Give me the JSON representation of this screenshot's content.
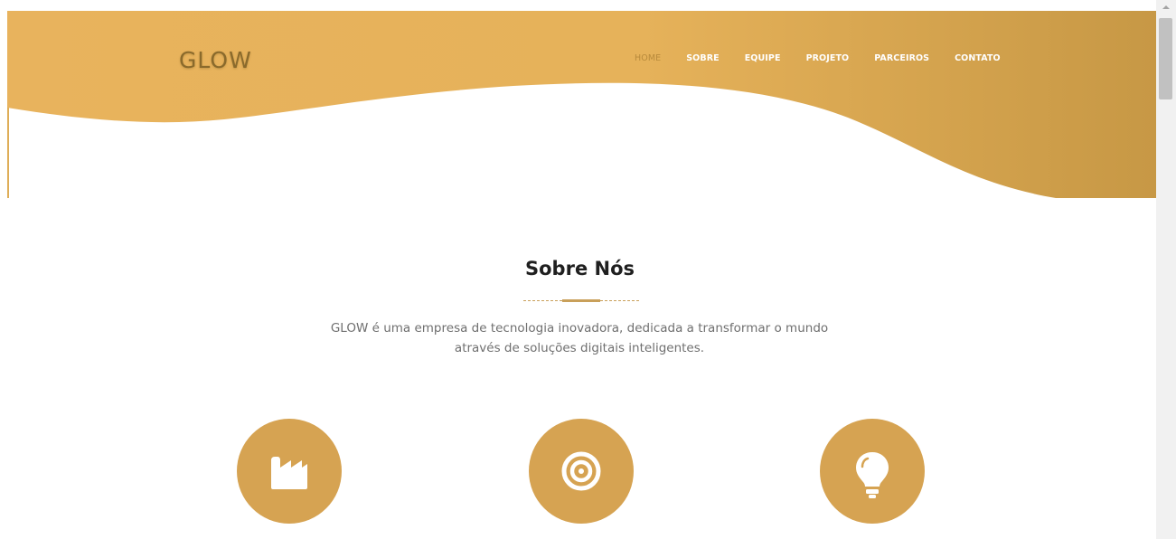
{
  "brand": {
    "logo_text": "GLOW"
  },
  "nav": {
    "items": [
      {
        "label": "HOME",
        "active": true
      },
      {
        "label": "SOBRE",
        "active": false
      },
      {
        "label": "EQUIPE",
        "active": false
      },
      {
        "label": "PROJETO",
        "active": false
      },
      {
        "label": "PARCEIROS",
        "active": false
      },
      {
        "label": "CONTATO",
        "active": false
      }
    ]
  },
  "about": {
    "title": "Sobre Nós",
    "description_line1": "GLOW é uma empresa de tecnologia inovadora, dedicada a transformar o mundo",
    "description_line2": "através de soluções digitais inteligentes."
  },
  "features": [
    {
      "icon": "factory-icon"
    },
    {
      "icon": "target-icon"
    },
    {
      "icon": "lightbulb-icon"
    }
  ],
  "colors": {
    "gold_light": "#e8b35d",
    "gold_dark": "#c79845",
    "icon_circle": "#d6a352",
    "active_nav": "#b98b3c"
  }
}
